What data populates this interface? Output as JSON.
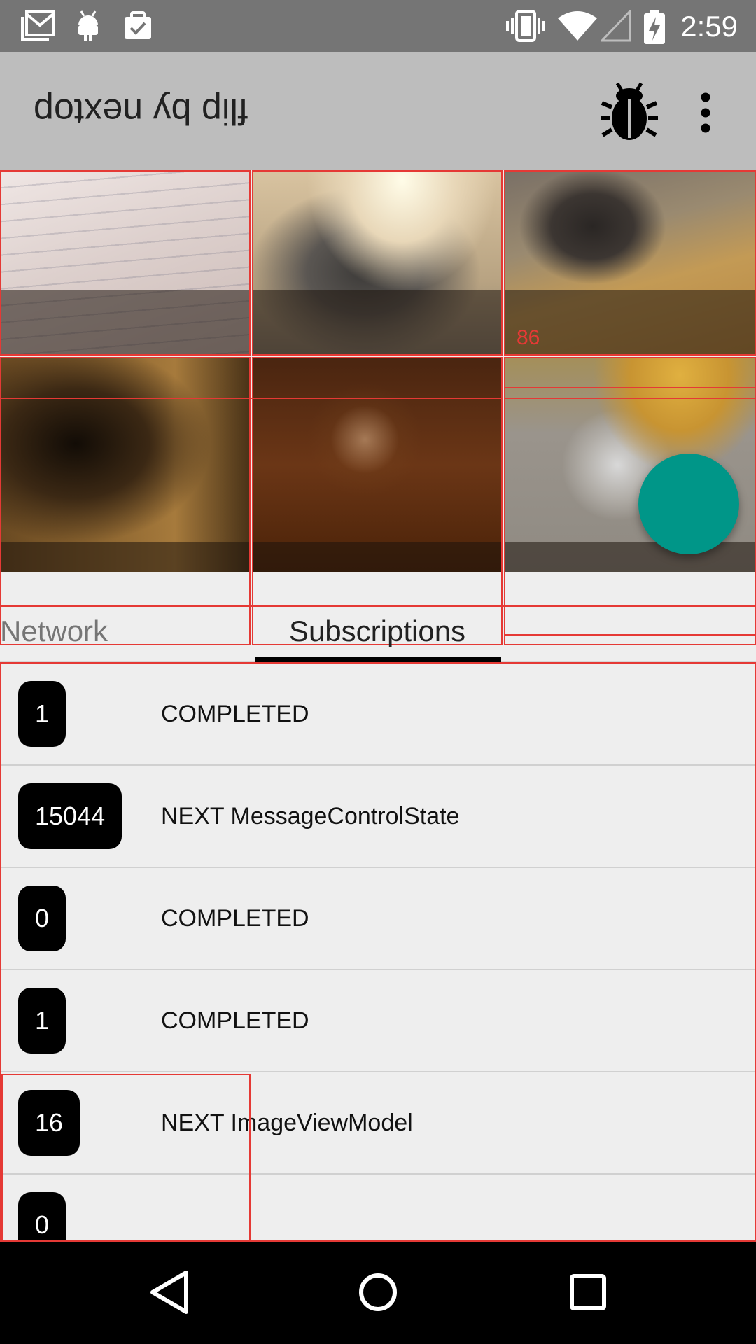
{
  "status_bar": {
    "time": "2:59",
    "left_icons": [
      "gmail-icon",
      "android-icon",
      "clipboard-check-icon"
    ],
    "right_icons": [
      "vibrate-icon",
      "wifi-icon",
      "signal-icon",
      "battery-charging-icon"
    ]
  },
  "app_bar": {
    "title": "flip by nextop",
    "actions": [
      "bug-icon",
      "overflow-menu-icon"
    ]
  },
  "grid": {
    "overlay_counter": "86",
    "tiles": [
      {
        "name": "photo-whiteboard"
      },
      {
        "name": "photo-blurred-desk"
      },
      {
        "name": "photo-office-chair"
      },
      {
        "name": "photo-dark-blur"
      },
      {
        "name": "photo-lamp-dark"
      },
      {
        "name": "photo-lamp-floor"
      }
    ]
  },
  "tabs": {
    "items": [
      {
        "label": "Network",
        "selected": false
      },
      {
        "label": "Subscriptions",
        "selected": true
      }
    ]
  },
  "events": [
    {
      "badge": "1",
      "text": "COMPLETED"
    },
    {
      "badge": "15044",
      "text": "NEXT MessageControlState"
    },
    {
      "badge": "0",
      "text": "COMPLETED"
    },
    {
      "badge": "1",
      "text": "COMPLETED"
    },
    {
      "badge": "16",
      "text": "NEXT ImageViewModel"
    },
    {
      "badge": "0",
      "text": ""
    }
  ],
  "nav_bar": {
    "buttons": [
      "back-icon",
      "home-icon",
      "recents-icon"
    ]
  },
  "colors": {
    "status_bar": "#757575",
    "app_bar": "#bdbdbd",
    "fab": "#009688",
    "debug_outline": "#e53935",
    "badge": "#000000"
  }
}
